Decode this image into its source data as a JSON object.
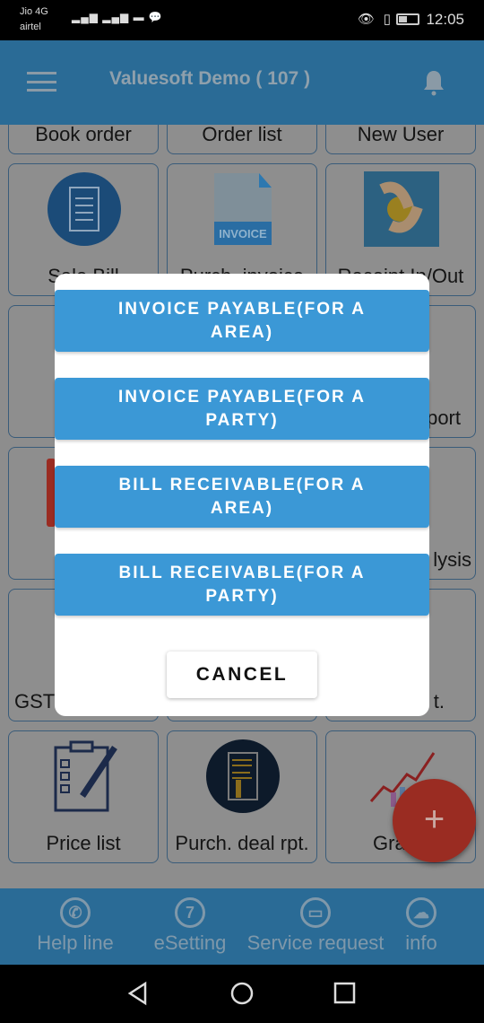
{
  "status_bar": {
    "carrier1": "Jio 4G",
    "carrier2": "airtel",
    "time": "12:05"
  },
  "header": {
    "title": "Valuesoft Demo ( 107 )"
  },
  "grid": {
    "row1": [
      "Book order",
      "Order list",
      "New User"
    ],
    "row2": [
      "Sale Bill",
      "Purch. invoice",
      "Receipt In/Out"
    ],
    "partial": {
      "r3c3": "port",
      "r4c3": "lysis",
      "r5c1": "GST",
      "r5c3": "t."
    },
    "row6": [
      "Price list",
      "Purch. deal rpt.",
      "Gra"
    ],
    "invoice_badge": "INVOICE"
  },
  "dialog": {
    "options": [
      "INVOICE PAYABLE(FOR A AREA)",
      "INVOICE PAYABLE(FOR A PARTY)",
      "BILL RECEIVABLE(FOR A AREA)",
      "BILL RECEIVABLE(FOR A PARTY)"
    ],
    "cancel": "CANCEL"
  },
  "bottom_nav": [
    {
      "label": "Help line",
      "icon": "phone-icon"
    },
    {
      "label": "eSetting",
      "icon": "seven-icon",
      "glyph": "7"
    },
    {
      "label": "Service request",
      "icon": "image-icon"
    },
    {
      "label": "info",
      "icon": "cloud-upload-icon"
    }
  ],
  "fab": {
    "label": "+",
    "color": "#c0392b"
  },
  "colors": {
    "primary": "#3b98d6",
    "header": "#2a6b96"
  }
}
